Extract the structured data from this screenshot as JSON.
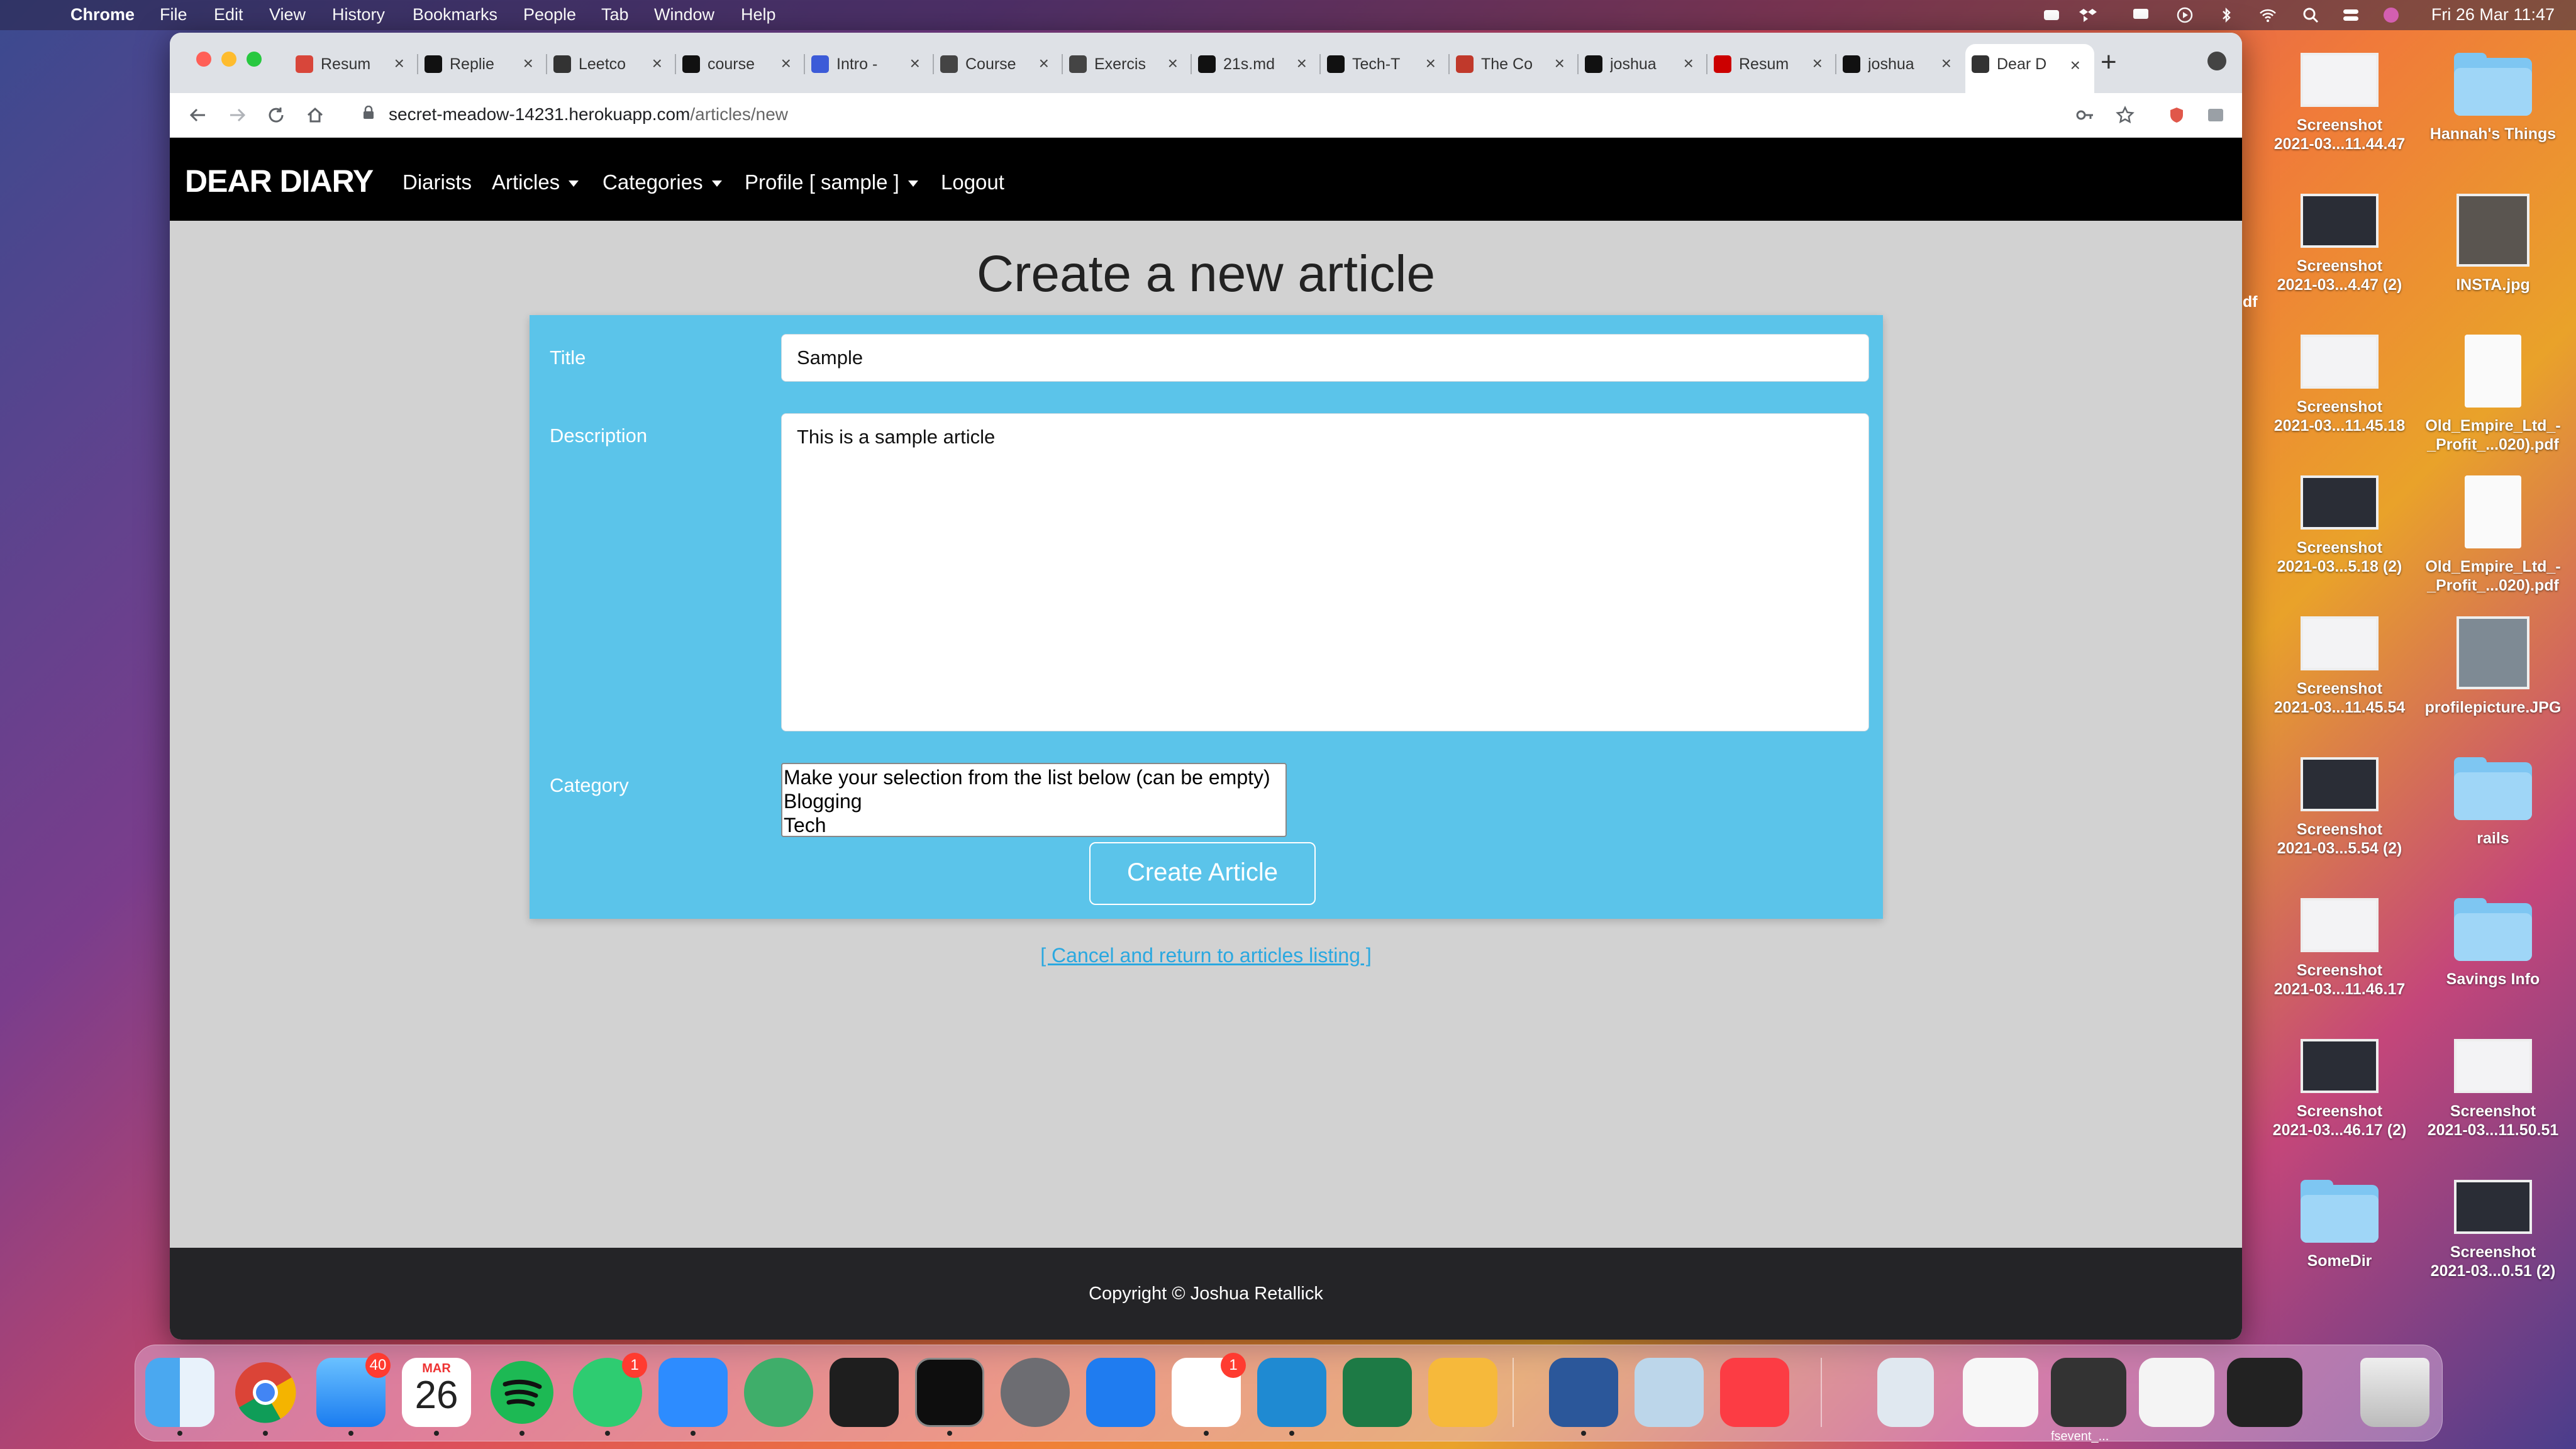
{
  "menubar": {
    "app": "Chrome",
    "items": [
      "File",
      "Edit",
      "View",
      "History",
      "Bookmarks",
      "People",
      "Tab",
      "Window",
      "Help"
    ],
    "clock": "Fri 26 Mar  11:47"
  },
  "browser": {
    "tabs": [
      {
        "label": "Resum",
        "icon": "s-icon",
        "color": "#d8463a"
      },
      {
        "label": "Replie",
        "icon": "github-icon",
        "color": "#111"
      },
      {
        "label": "Leetco",
        "icon": "globe-icon",
        "color": "#333"
      },
      {
        "label": "course",
        "icon": "github-icon",
        "color": "#111"
      },
      {
        "label": "Intro -",
        "icon": "v-icon",
        "color": "#3c5bd8"
      },
      {
        "label": "Course",
        "icon": "course-icon",
        "color": "#444"
      },
      {
        "label": "Exercis",
        "icon": "braces-icon",
        "color": "#444"
      },
      {
        "label": "21s.md",
        "icon": "github-icon",
        "color": "#111"
      },
      {
        "label": "Tech-T",
        "icon": "github-icon",
        "color": "#111"
      },
      {
        "label": "The Co",
        "icon": "w-icon",
        "color": "#c0392b"
      },
      {
        "label": "joshua",
        "icon": "github-icon",
        "color": "#111"
      },
      {
        "label": "Resum",
        "icon": "red-square-icon",
        "color": "#c00"
      },
      {
        "label": "joshua",
        "icon": "github-icon",
        "color": "#111"
      },
      {
        "label": "Dear D",
        "icon": "globe-icon",
        "color": "#333"
      }
    ],
    "url_host": "secret-meadow-14231.herokuapp.com",
    "url_path": "/articles/new"
  },
  "site": {
    "brand": "DEAR DIARY",
    "nav": {
      "diarists": "Diarists",
      "articles": "Articles",
      "categories": "Categories",
      "profile": "Profile [ sample ]",
      "logout": "Logout"
    },
    "page_title": "Create a new article",
    "form": {
      "title_label": "Title",
      "title_value": "Sample",
      "description_label": "Description",
      "description_value": "This is a sample article",
      "category_label": "Category",
      "category_options": [
        "Make your selection from the list below (can be empty)",
        "Blogging",
        "Tech"
      ],
      "submit_label": "Create Article"
    },
    "cancel_link": "[ Cancel and return to articles listing ]",
    "footer": "Copyright © Joshua Retallick"
  },
  "desktop": {
    "icons": [
      {
        "name": "Screenshot\n2021-03...11.44.47",
        "kind": "screenshot-light"
      },
      {
        "name": "Hannah's Things",
        "kind": "folder"
      },
      {
        "name": "Screenshot\n2021-03...4.47 (2)",
        "kind": "screenshot-dark"
      },
      {
        "name": "INSTA.jpg",
        "kind": "image"
      },
      {
        "name": "Screenshot\n2021-03...11.45.18",
        "kind": "screenshot-light"
      },
      {
        "name": "Old_Empire_Ltd_-\n_Profit_...020).pdf",
        "kind": "pdf"
      },
      {
        "name": "Screenshot\n2021-03...5.18 (2)",
        "kind": "screenshot-dark"
      },
      {
        "name": "Old_Empire_Ltd_-\n_Profit_...020).pdf",
        "kind": "pdf"
      },
      {
        "name": "Screenshot\n2021-03...11.45.54",
        "kind": "screenshot-light"
      },
      {
        "name": "profilepicture.JPG",
        "kind": "photo"
      },
      {
        "name": "Screenshot\n2021-03...5.54 (2)",
        "kind": "screenshot-dark"
      },
      {
        "name": "rails",
        "kind": "folder"
      },
      {
        "name": "Screenshot\n2021-03...11.46.17",
        "kind": "screenshot-light"
      },
      {
        "name": "Savings Info",
        "kind": "folder"
      },
      {
        "name": "Screenshot\n2021-03...46.17 (2)",
        "kind": "screenshot-dark"
      },
      {
        "name": "Screenshot\n2021-03...11.50.51",
        "kind": "screenshot-light"
      },
      {
        "name": "SomeDir",
        "kind": "folder"
      },
      {
        "name": "Screenshot\n2021-03...0.51 (2)",
        "kind": "screenshot-dark"
      }
    ],
    "partial_label": "df"
  },
  "dock": {
    "apps": [
      "finder",
      "chrome",
      "mail",
      "calendar",
      "spotify",
      "whatsapp",
      "zoom",
      "atom",
      "iterm",
      "terminal",
      "system-preferences",
      "xcode",
      "slack",
      "vscode",
      "excel",
      "tableplus",
      "word",
      "preview",
      "music"
    ],
    "mail_badge": "40",
    "whatsapp_badge": "1",
    "slack_badge": "1",
    "calendar_month": "MAR",
    "calendar_day": "26",
    "recent_label": "fsevent_..."
  }
}
